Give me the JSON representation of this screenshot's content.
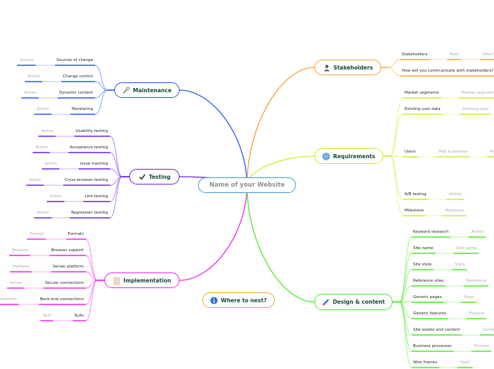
{
  "center": {
    "label": "Name of your Website",
    "color": "#3a9ad9"
  },
  "branches": [
    {
      "id": "maintenance",
      "label": "Maintenance",
      "icon": "wrench-icon",
      "color": "#2255ff",
      "side": "left",
      "children": [
        {
          "label": "Sources of change",
          "sub": [
            "Source"
          ]
        },
        {
          "label": "Change control",
          "sub": [
            "Action"
          ]
        },
        {
          "label": "Dynamic content",
          "sub": [
            "Action"
          ]
        },
        {
          "label": "Monitoring",
          "sub": [
            "Action"
          ]
        }
      ]
    },
    {
      "id": "testing",
      "label": "Testing",
      "icon": "checkmark-icon",
      "color": "#6a1aee",
      "side": "left",
      "children": [
        {
          "label": "Usability testing",
          "sub": [
            "Action"
          ]
        },
        {
          "label": "Acceptance testing",
          "sub": [
            "Action"
          ]
        },
        {
          "label": "Issue tracking",
          "sub": [
            "Action"
          ]
        },
        {
          "label": "Cross-browser testing",
          "sub": [
            "Action"
          ]
        },
        {
          "label": "Link testing",
          "sub": [
            "Action"
          ]
        },
        {
          "label": "Regression testing",
          "sub": [
            "Action"
          ]
        }
      ]
    },
    {
      "id": "implementation",
      "label": "Implementation",
      "icon": "clipboard-icon",
      "color": "#ee22ee",
      "side": "left",
      "children": [
        {
          "label": "Formats",
          "sub": [
            "Format"
          ]
        },
        {
          "label": "Browser support",
          "sub": [
            "Browser"
          ]
        },
        {
          "label": "Server platform",
          "sub": [
            "Platform"
          ]
        },
        {
          "label": "Secure connections",
          "sub": [
            "Action"
          ]
        },
        {
          "label": "Back-end connections",
          "sub": [
            "Connection"
          ]
        },
        {
          "label": "SLAs",
          "sub": [
            "SLA"
          ]
        }
      ]
    },
    {
      "id": "stakeholders",
      "label": "Stakeholders",
      "icon": "person-icon",
      "color": "#f9a030",
      "side": "right",
      "children": [
        {
          "label": "Stakeholders",
          "sub": [
            "Role",
            "Who?"
          ]
        },
        {
          "label": "How will you communicate with stakeholders?",
          "sub": []
        }
      ]
    },
    {
      "id": "requirements",
      "label": "Requirements",
      "icon": "globe-icon",
      "color": "#ccee22",
      "side": "right",
      "children": [
        {
          "label": "Market segments",
          "sub": [
            "Market segment"
          ]
        },
        {
          "label": "Existing user data",
          "sub": [
            "Existing data"
          ]
        },
        {
          "label": "Users",
          "sub": [
            "Add a persona",
            "Add"
          ]
        },
        {
          "label": "A/B testing",
          "sub": [
            "Action"
          ]
        },
        {
          "label": "Milestone",
          "sub": [
            "Milestone"
          ]
        }
      ]
    },
    {
      "id": "design",
      "label": "Design & content",
      "icon": "pencil-icon",
      "color": "#44ee22",
      "side": "right",
      "children": [
        {
          "label": "Keyword research",
          "sub": [
            "Action"
          ]
        },
        {
          "label": "Site name",
          "sub": [
            "Site name"
          ]
        },
        {
          "label": "Site style",
          "sub": [
            "Style"
          ]
        },
        {
          "label": "Reference sites",
          "sub": [
            "Reference"
          ]
        },
        {
          "label": "Generic pages",
          "sub": [
            "Page"
          ]
        },
        {
          "label": "Generic features",
          "sub": [
            "Feature"
          ]
        },
        {
          "label": "Site assets and content",
          "sub": [
            "Content"
          ]
        },
        {
          "label": "Business processes",
          "sub": [
            "Process"
          ]
        },
        {
          "label": "Wire frames",
          "sub": [
            "How?"
          ]
        }
      ]
    }
  ],
  "where_next": {
    "label": "Where to next?",
    "icon": "info-icon",
    "color": "#f5a623"
  }
}
